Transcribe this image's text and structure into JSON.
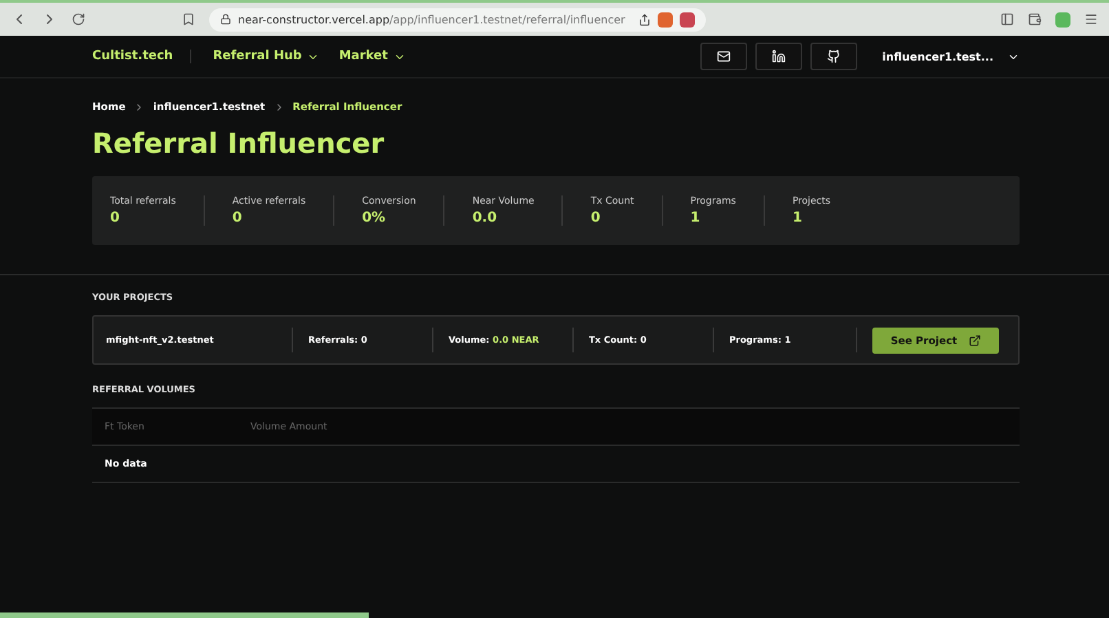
{
  "browser": {
    "url_host": "near-constructor.vercel.app",
    "url_path": "/app/influencer1.testnet/referral/influencer"
  },
  "nav": {
    "brand": "Cultist.tech",
    "menus": [
      "Referral Hub",
      "Market"
    ],
    "account": "influencer1.test..."
  },
  "breadcrumb": [
    {
      "label": "Home",
      "selected": false
    },
    {
      "label": "influencer1.testnet",
      "selected": false
    },
    {
      "label": "Referral Influencer",
      "selected": true
    }
  ],
  "title": "Referral Influencer",
  "stats": [
    {
      "label": "Total referrals",
      "value": "0"
    },
    {
      "label": "Active referrals",
      "value": "0"
    },
    {
      "label": "Conversion",
      "value": "0%"
    },
    {
      "label": "Near Volume",
      "value": "0.0"
    },
    {
      "label": "Tx Count",
      "value": "0"
    },
    {
      "label": "Programs",
      "value": "1"
    },
    {
      "label": "Projects",
      "value": "1"
    }
  ],
  "projects_heading": "YOUR PROJECTS",
  "projects": [
    {
      "name": "mfight-nft_v2.testnet",
      "referrals_label": "Referrals:",
      "referrals": "0",
      "volume_label": "Volume:",
      "volume": "0.0 NEAR",
      "tx_label": "Tx Count:",
      "tx": "0",
      "programs_label": "Programs:",
      "programs": "1",
      "button": "See Project"
    }
  ],
  "volumes_heading": "REFERRAL VOLUMES",
  "volumes_table": {
    "columns": [
      "Ft Token",
      "Volume Amount"
    ],
    "empty": "No data"
  }
}
